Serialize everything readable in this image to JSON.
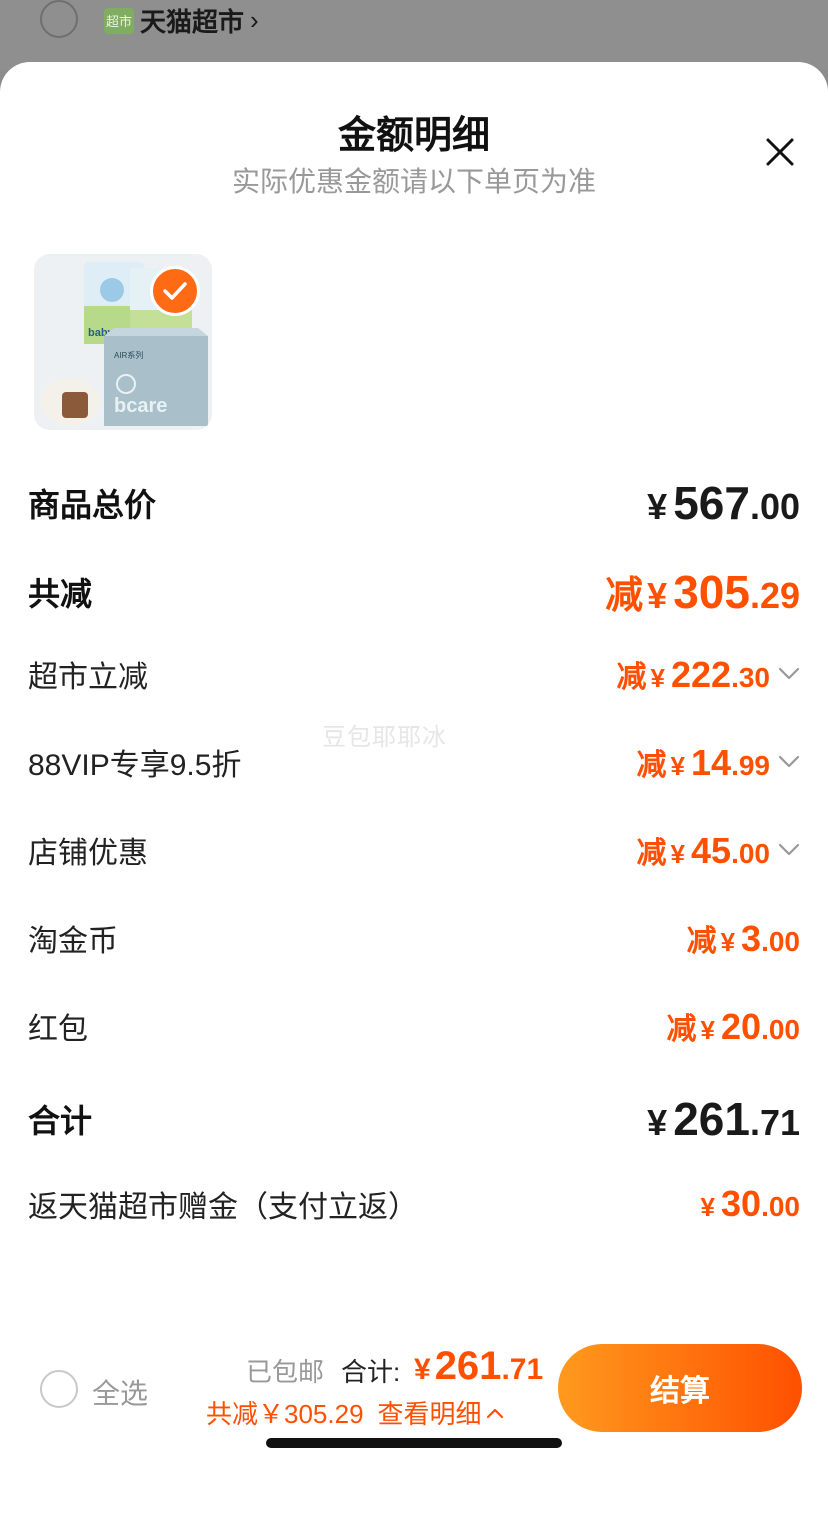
{
  "background": {
    "store_name": "天猫超市",
    "store_logo_text": "超市",
    "chevron": "›"
  },
  "sheet": {
    "title": "金额明细",
    "subtitle": "实际优惠金额请以下单页为准",
    "close_icon": "close-icon"
  },
  "product": {
    "brand_text": "babycare",
    "series_text": "AIR系列",
    "selected": true
  },
  "rows": {
    "subtotal": {
      "label": "商品总价",
      "symbol": "¥",
      "int": "567",
      "dec": ".00"
    },
    "total_discount": {
      "label": "共减",
      "prefix": "减",
      "symbol": "¥",
      "int": "305",
      "dec": ".29"
    },
    "market_discount": {
      "label": "超市立减",
      "prefix": "减",
      "symbol": "¥",
      "int": "222",
      "dec": ".30"
    },
    "vip_discount": {
      "label": "88VIP专享9.5折",
      "prefix": "减",
      "symbol": "¥",
      "int": "14",
      "dec": ".99"
    },
    "shop_discount": {
      "label": "店铺优惠",
      "prefix": "减",
      "symbol": "¥",
      "int": "45",
      "dec": ".00"
    },
    "coins": {
      "label": "淘金币",
      "prefix": "减",
      "symbol": "¥",
      "int": "3",
      "dec": ".00"
    },
    "red_packet": {
      "label": "红包",
      "prefix": "减",
      "symbol": "¥",
      "int": "20",
      "dec": ".00"
    },
    "total": {
      "label": "合计",
      "symbol": "¥",
      "int": "261",
      "dec": ".71"
    },
    "cashback": {
      "label": "返天猫超市赠金（支付立返）",
      "symbol": "¥",
      "int": "30",
      "dec": ".00"
    }
  },
  "watermark": "豆包耶耶冰",
  "bottom_bar": {
    "select_all_label": "全选",
    "shipping_text": "已包邮",
    "total_label": "合计:",
    "total_symbol": "¥",
    "total_int": "261",
    "total_dec": ".71",
    "saved_text": "共减￥305.29",
    "detail_link": "查看明细",
    "checkout_label": "结算"
  },
  "colors": {
    "accent": "#ff5000",
    "accent_light": "#ff9a1e",
    "muted": "#999999"
  }
}
